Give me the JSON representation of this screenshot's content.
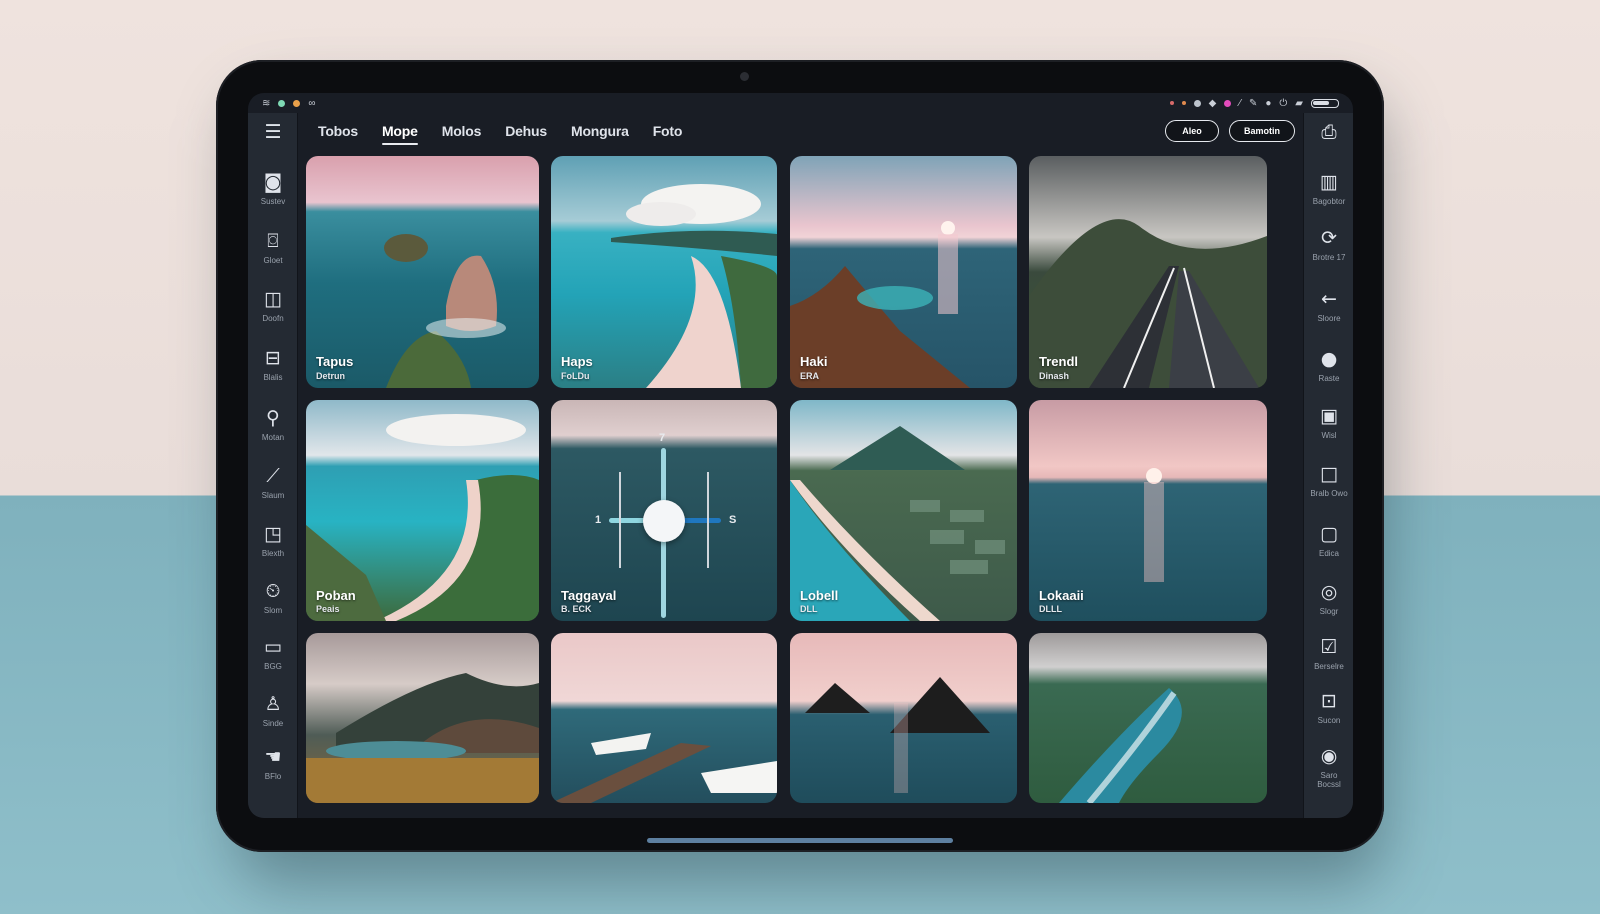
{
  "statusbar": {
    "left_icons": [
      "menu-lines-icon",
      "wifi-icon",
      "signal-icon",
      "link-icon"
    ],
    "right_icons": [
      "dot-icon",
      "dot-icon",
      "dot-icon",
      "record-icon",
      "tag-icon",
      "dot-icon",
      "pen-icon",
      "edit-icon",
      "cloud-icon",
      "power-icon",
      "battery-icon"
    ]
  },
  "nav": {
    "tabs": [
      "Tobos",
      "Mope",
      "Molos",
      "Dehus",
      "Mongura",
      "Foto"
    ],
    "active_tab": "Mope",
    "buttons": [
      "Aleo",
      "Bamotin"
    ]
  },
  "left_sidebar": [
    {
      "icon": "menu-icon",
      "label": ""
    },
    {
      "icon": "camera-roll-icon",
      "label": "Sustev"
    },
    {
      "icon": "camera-icon",
      "label": "Gloet"
    },
    {
      "icon": "split-view-icon",
      "label": "Doofn"
    },
    {
      "icon": "album-icon",
      "label": "Blalis"
    },
    {
      "icon": "key-icon",
      "label": "Motan"
    },
    {
      "icon": "brush-icon",
      "label": "Slaum"
    },
    {
      "icon": "frame-icon",
      "label": "Blexth"
    },
    {
      "icon": "timer-icon",
      "label": "Slom"
    },
    {
      "icon": "display-icon",
      "label": "BGG"
    },
    {
      "icon": "person-icon",
      "label": "Sinde"
    },
    {
      "icon": "hand-icon",
      "label": "BFlo"
    }
  ],
  "right_sidebar": [
    {
      "icon": "export-icon",
      "label": ""
    },
    {
      "icon": "columns-icon",
      "label": "Bagobtor"
    },
    {
      "icon": "rotate-icon",
      "label": "Brotre 17"
    },
    {
      "icon": "back-arrow-icon",
      "label": "Sloore"
    },
    {
      "icon": "apple-icon",
      "label": "Raste"
    },
    {
      "icon": "window-icon",
      "label": "Wisl"
    },
    {
      "icon": "square-icon",
      "label": "Bralb Owo"
    },
    {
      "icon": "square-outline-icon",
      "label": "Edica"
    },
    {
      "icon": "target-icon",
      "label": "Slogr"
    },
    {
      "icon": "check-icon",
      "label": "Berselre"
    },
    {
      "icon": "square-dot-icon",
      "label": "Sucon"
    },
    {
      "icon": "stop-icon",
      "label": "Saro Bocssl"
    }
  ],
  "photos": [
    {
      "title": "Tapus",
      "subtitle": "Detrun",
      "scene": "sea-rocks"
    },
    {
      "title": "Haps",
      "subtitle": "FoLDu",
      "scene": "beach"
    },
    {
      "title": "Haki",
      "subtitle": "ERA",
      "scene": "sunset-mountain"
    },
    {
      "title": "Trendl",
      "subtitle": "Dinash",
      "scene": "road"
    },
    {
      "title": "Poban",
      "subtitle": "Peais",
      "scene": "bay"
    },
    {
      "title": "Taggayal",
      "subtitle": "B. ECK",
      "scene": "slider"
    },
    {
      "title": "Lobell",
      "subtitle": "DLL",
      "scene": "volcano"
    },
    {
      "title": "Lokaaii",
      "subtitle": "DLLL",
      "scene": "ocean-sunset"
    },
    {
      "title": "",
      "subtitle": "",
      "scene": "valley"
    },
    {
      "title": "",
      "subtitle": "",
      "scene": "ships"
    },
    {
      "title": "",
      "subtitle": "",
      "scene": "twin-peaks"
    },
    {
      "title": "",
      "subtitle": "",
      "scene": "coast"
    }
  ],
  "slider_labels": {
    "top": "7",
    "left": "1",
    "right": "S"
  },
  "colors": {
    "accent": "#5fc8da",
    "frame": "#0c0d10",
    "screen": "#191d25",
    "sidebar": "#242a33"
  }
}
